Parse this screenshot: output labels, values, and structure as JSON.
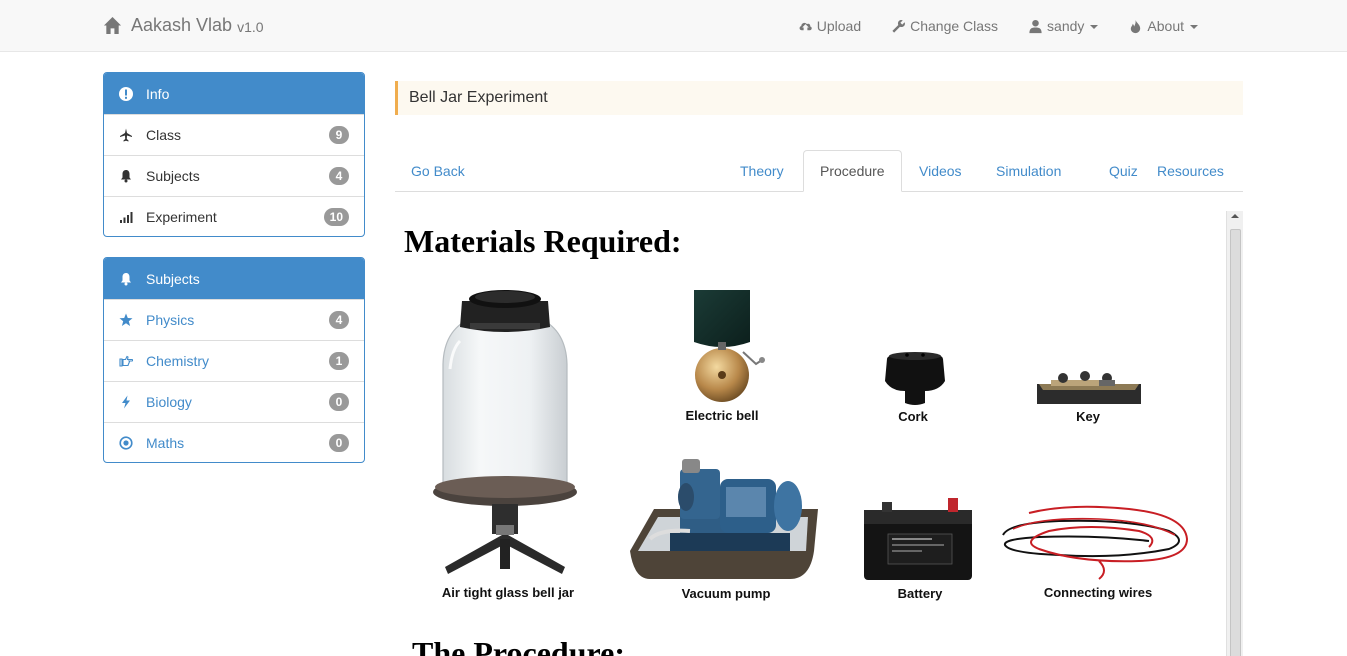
{
  "navbar": {
    "brand": "Aakash Vlab",
    "version": "v1.0",
    "items": [
      {
        "label": "Upload",
        "icon": "cloud-upload-icon"
      },
      {
        "label": "Change Class",
        "icon": "wrench-icon"
      },
      {
        "label": "sandy",
        "icon": "user-icon"
      },
      {
        "label": "About",
        "icon": "fire-icon"
      }
    ]
  },
  "info_panel": {
    "heading": "Info",
    "items": [
      {
        "label": "Class",
        "count": "9",
        "icon": "plane-icon"
      },
      {
        "label": "Subjects",
        "count": "4",
        "icon": "bell-icon"
      },
      {
        "label": "Experiment",
        "count": "10",
        "icon": "signal-icon"
      }
    ]
  },
  "subjects_panel": {
    "heading": "Subjects",
    "items": [
      {
        "label": "Physics",
        "count": "4",
        "icon": "star-icon"
      },
      {
        "label": "Chemistry",
        "count": "1",
        "icon": "hand-right-icon"
      },
      {
        "label": "Biology",
        "count": "0",
        "icon": "flash-icon"
      },
      {
        "label": "Maths",
        "count": "0",
        "icon": "record-icon"
      }
    ]
  },
  "alert": {
    "title": "Bell Jar Experiment"
  },
  "tabs": {
    "go_back": "Go Back",
    "items": [
      "Theory",
      "Procedure",
      "Videos",
      "Simulation",
      "Quiz",
      "Resources"
    ],
    "active": "Procedure"
  },
  "content": {
    "materials_heading": "Materials Required:",
    "procedure_heading": "The Procedure:",
    "materials": [
      "Air tight glass bell jar",
      "Electric bell",
      "Cork",
      "Key",
      "Vacuum pump",
      "Battery",
      "Connecting wires"
    ]
  },
  "colors": {
    "primary": "#428bca",
    "navbar_bg": "#f8f8f8",
    "alert_border": "#f0ad4e",
    "badge": "#999999"
  }
}
